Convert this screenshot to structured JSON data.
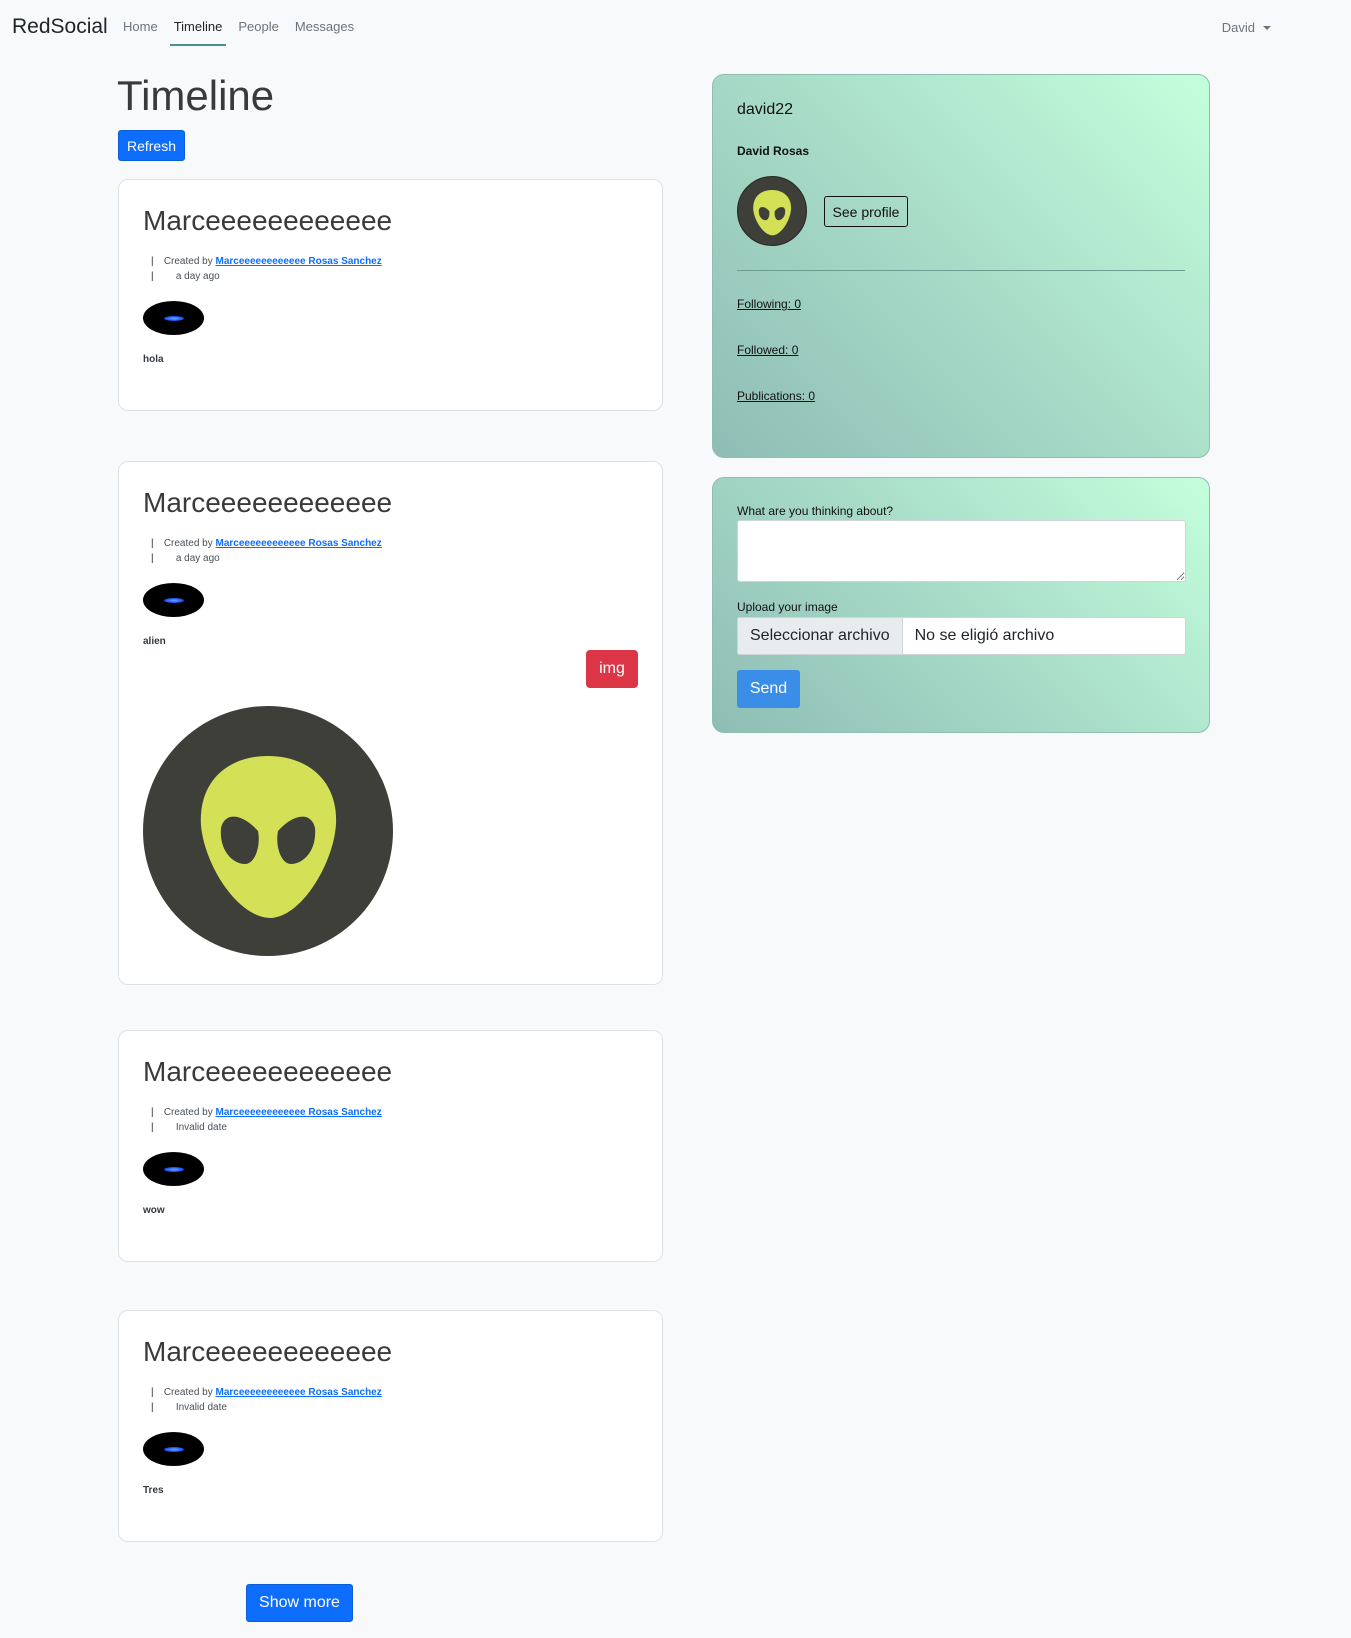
{
  "navbar": {
    "brand": "RedSocial",
    "links": [
      "Home",
      "Timeline",
      "People",
      "Messages"
    ],
    "active": "Timeline",
    "user": "David"
  },
  "timeline": {
    "title": "Timeline",
    "refresh_label": "Refresh",
    "created_by_prefix": "Created by",
    "show_more_label": "Show more",
    "posts": [
      {
        "title": "Marceeeeeeeeeeee",
        "author": "Marceeeeeeeeeeee Rosas Sanchez",
        "date": "a day ago",
        "text": "hola"
      },
      {
        "title": "Marceeeeeeeeeeee",
        "author": "Marceeeeeeeeeeee Rosas Sanchez",
        "date": "a day ago",
        "text": "alien",
        "image_button": "img",
        "image_icon": "alien-face-icon"
      },
      {
        "title": "Marceeeeeeeeeeee",
        "author": "Marceeeeeeeeeeee Rosas Sanchez",
        "date": "Invalid date",
        "text": "wow"
      },
      {
        "title": "Marceeeeeeeeeeee",
        "author": "Marceeeeeeeeeeee Rosas Sanchez",
        "date": "Invalid date",
        "text": "Tres"
      }
    ]
  },
  "profile": {
    "username": "david22",
    "fullname": "David Rosas",
    "see_profile_label": "See profile",
    "following": "Following: 0",
    "followed": "Followed: 0",
    "publications": "Publications: 0"
  },
  "compose": {
    "thinking_label": "What are you thinking about?",
    "textarea_value": "",
    "upload_label": "Upload your image",
    "file_button": "Seleccionar archivo",
    "file_status": "No se eligió archivo",
    "send_label": "Send"
  },
  "colors": {
    "primary": "#0d6efd",
    "danger": "#dc3545",
    "card_gradient_start": "#c4ffdc",
    "card_gradient_end": "#8fbdb5",
    "alien_face": "#d4e157",
    "alien_bg": "#3f3f3a"
  }
}
